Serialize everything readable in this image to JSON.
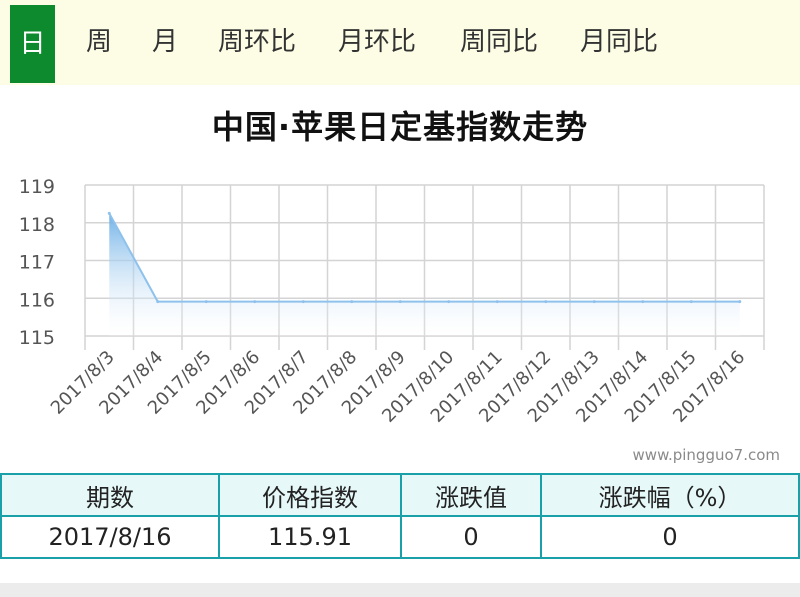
{
  "tabs": [
    {
      "label": "日",
      "active": true
    },
    {
      "label": "周"
    },
    {
      "label": "月"
    },
    {
      "label": "周环比"
    },
    {
      "label": "月环比"
    },
    {
      "label": "周同比"
    },
    {
      "label": "月同比"
    }
  ],
  "colors": {
    "active_tab": "#0e8a2e",
    "tab_bar": "#fdfde6",
    "line": "#8ec1ec",
    "table_border": "#1aa0a8",
    "table_header": "#e6f8f8"
  },
  "chart_data": {
    "type": "area",
    "title": "中国·苹果日定基指数走势",
    "xlabel": "",
    "ylabel": "",
    "categories": [
      "2017/8/3",
      "2017/8/4",
      "2017/8/5",
      "2017/8/6",
      "2017/8/7",
      "2017/8/8",
      "2017/8/9",
      "2017/8/10",
      "2017/8/11",
      "2017/8/12",
      "2017/8/13",
      "2017/8/14",
      "2017/8/15",
      "2017/8/16"
    ],
    "values": [
      118.25,
      115.91,
      115.91,
      115.91,
      115.91,
      115.91,
      115.91,
      115.91,
      115.91,
      115.91,
      115.91,
      115.91,
      115.91,
      115.91
    ],
    "ylim": [
      115,
      119
    ],
    "yticks": [
      "115",
      "116",
      "117",
      "118",
      "119"
    ],
    "grid": true
  },
  "watermark": "www.pingguo7.com",
  "table": {
    "headers": [
      "期数",
      "价格指数",
      "涨跌值",
      "涨跌幅（%）"
    ],
    "row": [
      "2017/8/16",
      "115.91",
      "0",
      "0"
    ]
  }
}
